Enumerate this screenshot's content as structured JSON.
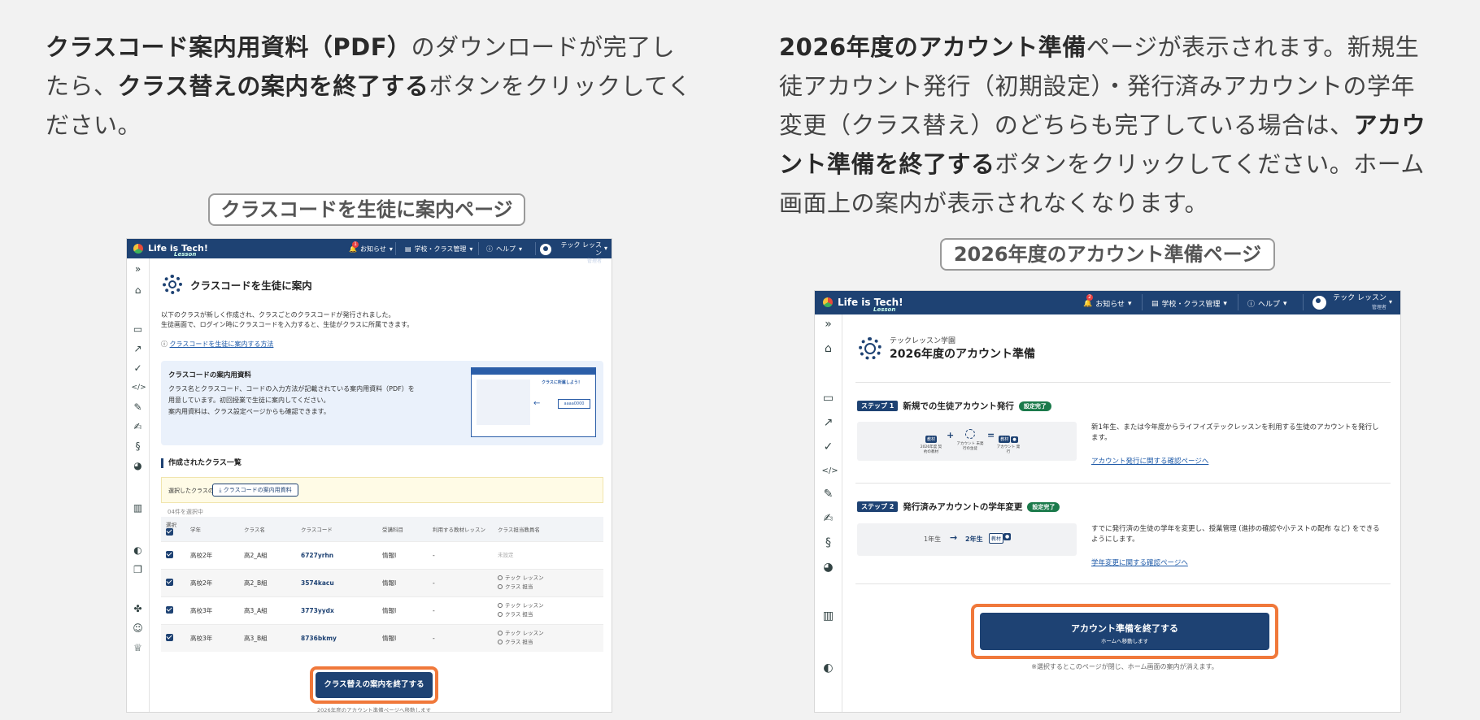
{
  "left_instruction": {
    "bold1": "クラスコード案内用資料（PDF）",
    "text1": "のダウンロードが完了したら、",
    "bold2": "クラス替えの案内を終了する",
    "text2": "ボタンをクリックしてください。"
  },
  "right_instruction": {
    "bold1": "2026年度のアカウント準備",
    "text1": "ページが表示されます。新規生徒アカウント発行（初期設定）・発行済みアカウントの学年変更（クラス替え）のどちらも完了している場合は、",
    "bold2": "アカウント準備を終了する",
    "text2": "ボタンをクリックしてください。ホーム画面上の案内が表示されなくなります。"
  },
  "left_caption": "クラスコードを生徒に案内ページ",
  "right_caption": "2026年度のアカウント準備ページ",
  "app": {
    "logo": "Life is Tech!",
    "logo_sub": "Lesson",
    "nav": {
      "notice": "お知らせ",
      "notice_badge": "1",
      "notice_badge_right": "2",
      "school": "学校・クラス管理",
      "help": "ヘルプ",
      "user_name": "テック レッスン",
      "user_role": "管理者"
    }
  },
  "left_screen": {
    "page_title": "クラスコードを生徒に案内",
    "intro_line1": "以下のクラスが新しく作成され、クラスごとのクラスコードが発行されました。",
    "intro_line2": "生徒画面で、ログイン時にクラスコードを入力すると、生徒がクラスに所属できます。",
    "howto_link": "クラスコードを生徒に案内する方法",
    "info_title": "クラスコードの案内用資料",
    "info_line1": "クラス名とクラスコード、コードの入力方法が記載されている案内用資料（PDF）を",
    "info_line2": "用意しています。初回授業で生徒に案内してください。",
    "info_line3": "案内用資料は、クラス設定ページからも確認できます。",
    "doc_heading": "クラスに所属しよう！",
    "doc_code": "aaaa0000",
    "list_title": "作成されたクラス一覧",
    "selected_label": "選択したクラスの",
    "download_button": "クラスコードの案内用資料",
    "count_text": "04件を選択中",
    "columns": [
      "選択",
      "学年",
      "クラス名",
      "クラスコード",
      "受講科目",
      "利用する教材レッスン",
      "クラス担当教員名"
    ],
    "rows": [
      {
        "grade": "高校2年",
        "class": "高2_A組",
        "code": "6727yrhn",
        "subject": "情報Ⅰ",
        "lesson": "-",
        "teacher1": "未設定",
        "teacher2": ""
      },
      {
        "grade": "高校2年",
        "class": "高2_B組",
        "code": "3574kacu",
        "subject": "情報Ⅰ",
        "lesson": "-",
        "teacher1": "テック レッスン",
        "teacher2": "クラス 担当"
      },
      {
        "grade": "高校3年",
        "class": "高3_A組",
        "code": "3773yydx",
        "subject": "情報Ⅰ",
        "lesson": "-",
        "teacher1": "テック レッスン",
        "teacher2": "クラス 担当"
      },
      {
        "grade": "高校3年",
        "class": "高3_B組",
        "code": "8736bkmy",
        "subject": "情報Ⅰ",
        "lesson": "-",
        "teacher1": "テック レッスン",
        "teacher2": "クラス 担当"
      }
    ],
    "finish_button": "クラス替えの案内を終了する",
    "finish_note": "2026年度のアカウント準備ページへ移動します"
  },
  "right_screen": {
    "school_name": "テックレッスン学園",
    "page_title": "2026年度のアカウント準備",
    "step1_tag": "ステップ 1",
    "step1_title": "新規での生徒アカウント発行",
    "step1_badge": "設定完了",
    "step1_desc": "新1年生、または今年度からライフイズテックレッスンを利用する生徒のアカウントを発行します。",
    "step1_link": "アカウント発行に関する確認ページへ",
    "step1_fig1": "2026年度 契約の教材",
    "step1_fig2": "アカウント 未発行の生徒",
    "step1_fig3": "アカウント 発行",
    "step2_tag": "ステップ 2",
    "step2_title": "発行済みアカウントの学年変更",
    "step2_badge": "設定完了",
    "step2_desc": "すでに発行済の生徒の学年を変更し、授業管理 (進捗の確認や小テストの配布 など) をできるようにします。",
    "step2_link": "学年変更に関する確認ページへ",
    "step2_from": "1年生",
    "step2_to": "2年生",
    "finish_button": "アカウント準備を終了する",
    "finish_sub": "ホームへ移動します",
    "finish_note": "※選択するとこのページが閉じ、ホーム画面の案内が消えます。"
  }
}
